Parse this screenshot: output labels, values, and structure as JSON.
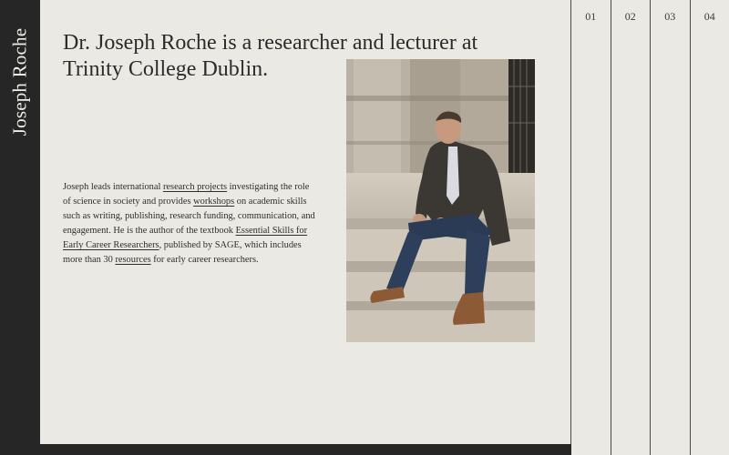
{
  "sidebar": {
    "name": "Joseph Roche"
  },
  "headline": "Dr. Joseph Roche is a researcher and lecturer at Trinity College Dublin.",
  "bio": {
    "t1": "Joseph leads international ",
    "link_research_projects": "research projects",
    "t2": " investigating the role of science in society and provides ",
    "link_workshops": "workshops",
    "t3": " on academic skills such as writing, publishing, research funding, communication, and engagement. He is the author of the textbook ",
    "link_textbook": "Essential Skills for Early Career Researchers",
    "t4": ", published by SAGE, which includes more than 30 ",
    "link_resources": "resources",
    "t5": " for early career researchers."
  },
  "nav": {
    "col1": "01",
    "col2": "02",
    "col3": "03",
    "col4": "04"
  },
  "colors": {
    "background": "#ebe9e4",
    "dark": "#262626",
    "text": "#2b2b2b"
  }
}
